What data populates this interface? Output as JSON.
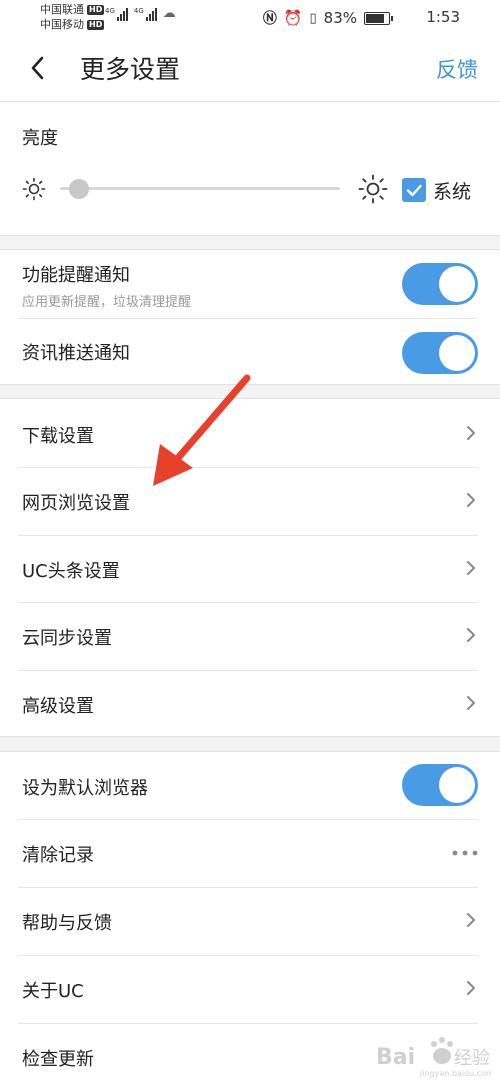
{
  "status_bar": {
    "carrier1": "中国联通",
    "carrier2": "中国移动",
    "hd": "HD",
    "net1": "4G",
    "net2": "4G",
    "battery": "83%",
    "battery_level": 0.83,
    "time": "1:53"
  },
  "header": {
    "title": "更多设置",
    "feedback": "反馈"
  },
  "brightness": {
    "label": "亮度",
    "level": 0.04,
    "system_label": "系统",
    "system_checked": true
  },
  "notifications": {
    "items": [
      {
        "label": "功能提醒通知",
        "sublabel": "应用更新提醒，垃圾清理提醒",
        "on": true
      },
      {
        "label": "资讯推送通知",
        "on": true
      }
    ]
  },
  "settings_menu": {
    "items": [
      {
        "label": "下载设置"
      },
      {
        "label": "网页浏览设置"
      },
      {
        "label": "UC头条设置"
      },
      {
        "label": "云同步设置"
      },
      {
        "label": "高级设置"
      }
    ]
  },
  "misc": {
    "items": [
      {
        "label": "设为默认浏览器",
        "on": true
      },
      {
        "label": "清除记录"
      },
      {
        "label": "帮助与反馈"
      },
      {
        "label": "关于UC"
      },
      {
        "label": "检查更新"
      }
    ]
  },
  "colors": {
    "accent": "#4a9be6",
    "link": "#3b94d9",
    "annotation": "#e8402a"
  },
  "icons": {
    "back": "chevron-left-icon",
    "chevron": "chevron-right-icon",
    "more": "more-dots-icon",
    "brightness": "sun-icon"
  }
}
